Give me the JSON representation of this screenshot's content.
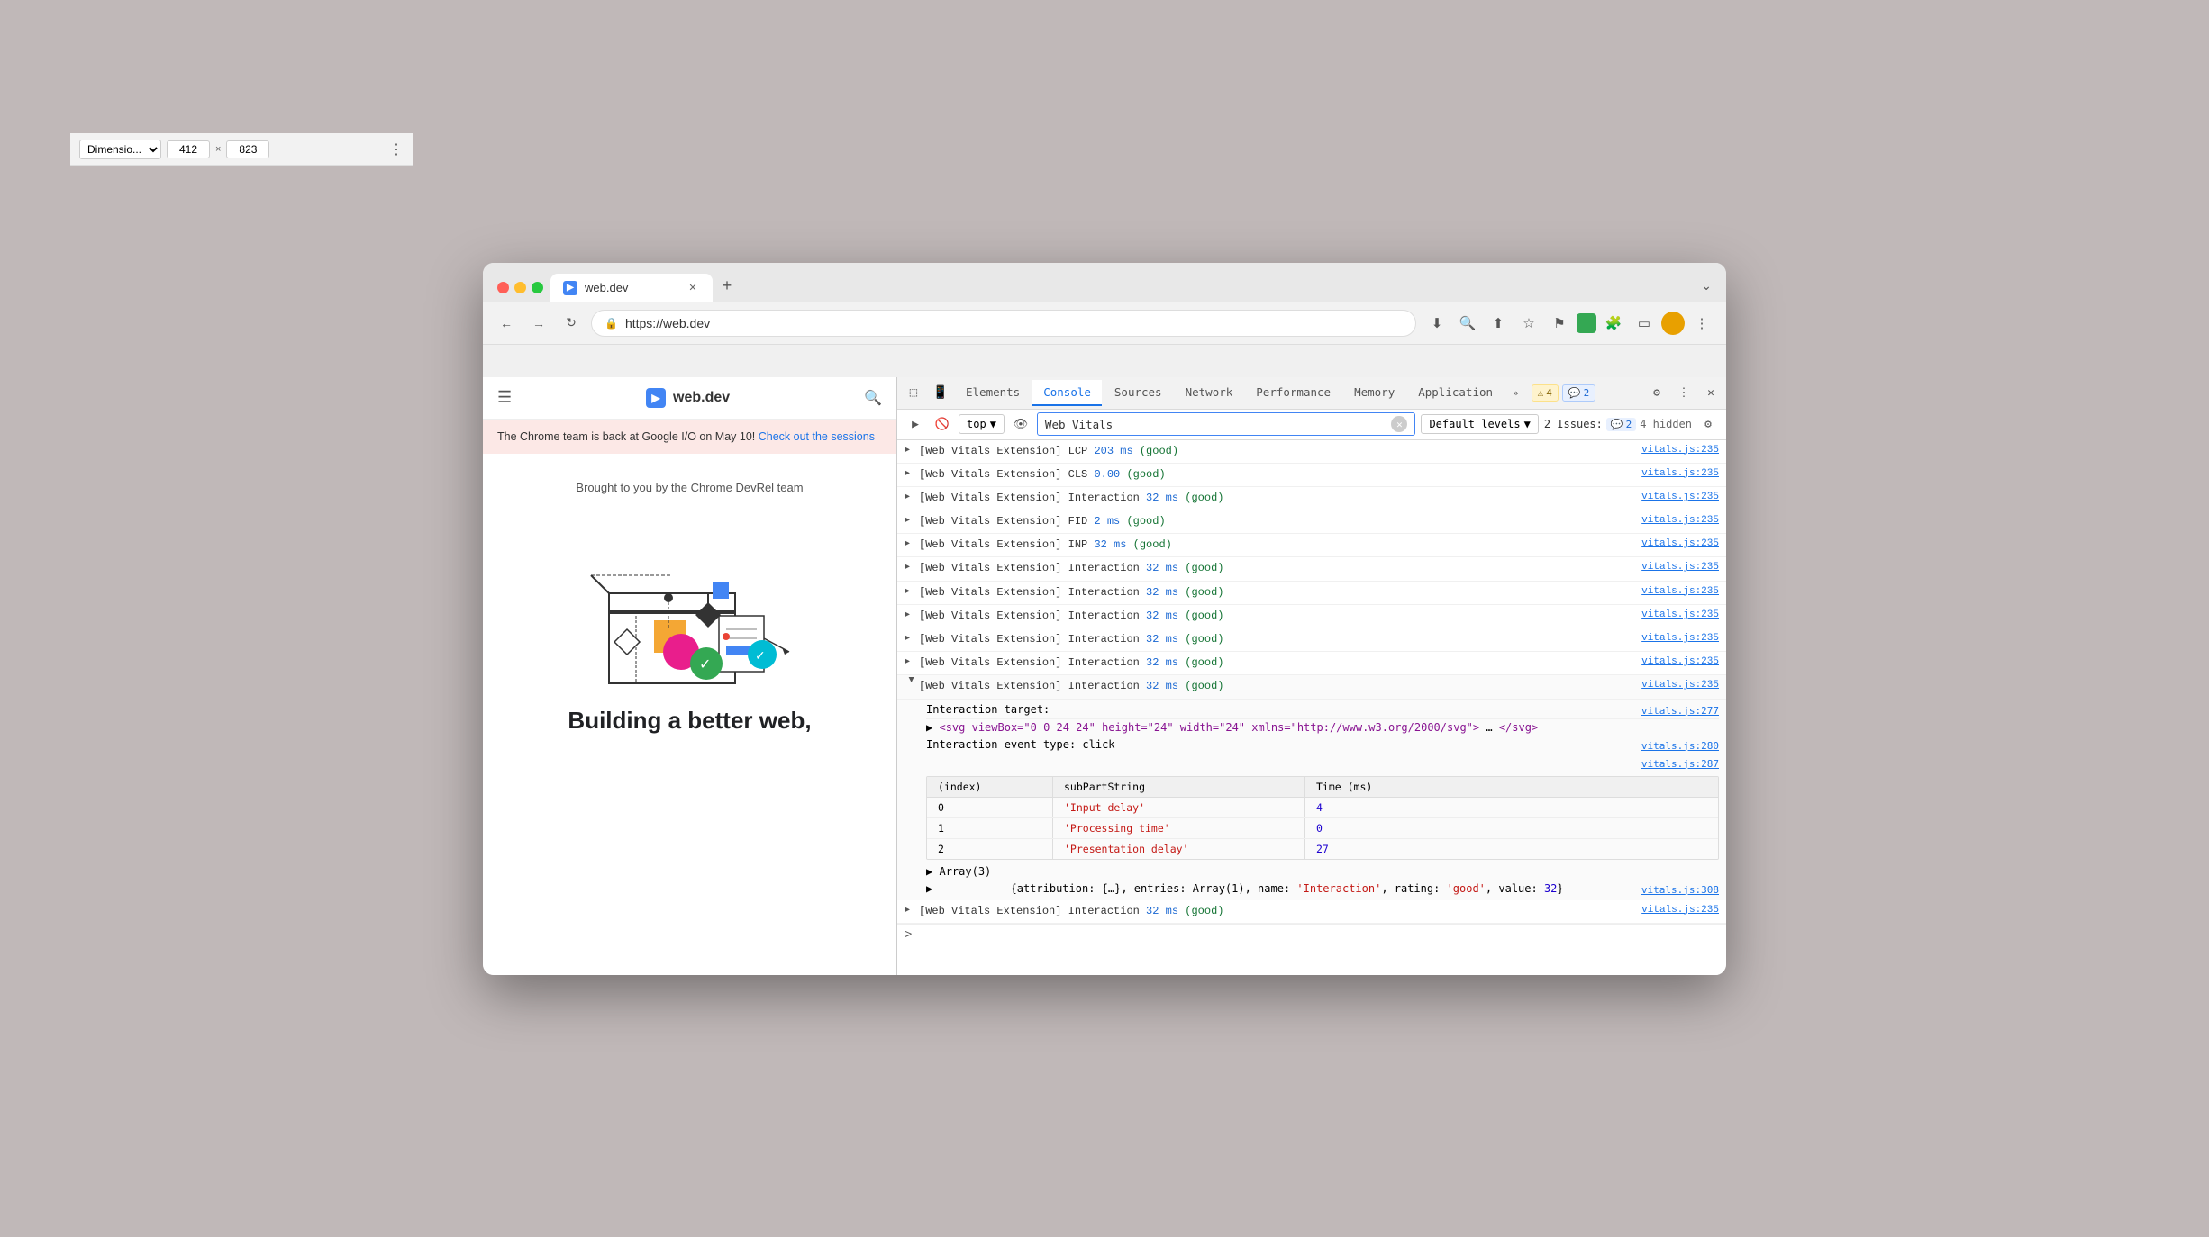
{
  "browser": {
    "tab_title": "web.dev",
    "tab_favicon": "▶",
    "url": "https://web.dev",
    "new_tab_label": "+",
    "chevron_down": "⌄",
    "nav": {
      "back_label": "←",
      "forward_label": "→",
      "reload_label": "↻",
      "lock_label": "🔒",
      "download_label": "⬇",
      "zoom_label": "🔍",
      "share_label": "⬆",
      "star_label": "☆",
      "flag_label": "⚑",
      "ext_label": "🟩",
      "puzzle_label": "🧩",
      "sidebar_label": "▭",
      "profile_label": "👤",
      "more_label": "⋮"
    }
  },
  "devtools": {
    "dimension_label": "Dimensio...",
    "width": "412",
    "x_label": "×",
    "height": "823",
    "more_dots": "⋮",
    "inspect_icon": "⬚",
    "device_icon": "📱",
    "tabs": [
      {
        "label": "Elements",
        "active": false
      },
      {
        "label": "Console",
        "active": true
      },
      {
        "label": "Sources",
        "active": false
      },
      {
        "label": "Network",
        "active": false
      },
      {
        "label": "Performance",
        "active": false
      },
      {
        "label": "Memory",
        "active": false
      },
      {
        "label": "Application",
        "active": false
      }
    ],
    "more_tabs": "»",
    "badge_warn_count": "4",
    "badge_warn_icon": "⚠",
    "badge_info_count": "2",
    "badge_info_icon": "💬",
    "settings_icon": "⚙",
    "more_icon": "⋮",
    "close_icon": "✕",
    "console": {
      "exec_icon": "▶",
      "stop_icon": "🚫",
      "context_label": "top",
      "context_arrow": "▼",
      "eye_icon": "👁",
      "filter_text": "Web Vitals",
      "filter_clear": "✕",
      "levels_label": "Default levels",
      "levels_arrow": "▼",
      "issues_label": "2 Issues:",
      "issues_count": "2",
      "hidden_label": "4 hidden",
      "gear_icon": "⚙"
    },
    "log_entries": [
      {
        "expanded": false,
        "text_parts": [
          {
            "type": "prefix",
            "text": "[Web Vitals Extension] LCP "
          },
          {
            "type": "value",
            "text": "203 ms"
          },
          {
            "type": "good",
            "text": " (good)"
          }
        ],
        "source": "vitals.js:235"
      },
      {
        "expanded": false,
        "text_parts": [
          {
            "type": "prefix",
            "text": "[Web Vitals Extension] CLS "
          },
          {
            "type": "value",
            "text": "0.00"
          },
          {
            "type": "good",
            "text": " (good)"
          }
        ],
        "source": "vitals.js:235"
      },
      {
        "expanded": false,
        "text_parts": [
          {
            "type": "prefix",
            "text": "[Web Vitals Extension] Interaction "
          },
          {
            "type": "value",
            "text": "32 ms"
          },
          {
            "type": "good",
            "text": " (good)"
          }
        ],
        "source": "vitals.js:235"
      },
      {
        "expanded": false,
        "text_parts": [
          {
            "type": "prefix",
            "text": "[Web Vitals Extension] FID "
          },
          {
            "type": "value",
            "text": "2 ms"
          },
          {
            "type": "good",
            "text": " (good)"
          }
        ],
        "source": "vitals.js:235"
      },
      {
        "expanded": false,
        "text_parts": [
          {
            "type": "prefix",
            "text": "[Web Vitals Extension] INP "
          },
          {
            "type": "value",
            "text": "32 ms"
          },
          {
            "type": "good",
            "text": " (good)"
          }
        ],
        "source": "vitals.js:235"
      },
      {
        "expanded": false,
        "text_parts": [
          {
            "type": "prefix",
            "text": "[Web Vitals Extension] Interaction "
          },
          {
            "type": "value",
            "text": "32 ms"
          },
          {
            "type": "good",
            "text": " (good)"
          }
        ],
        "source": "vitals.js:235"
      },
      {
        "expanded": false,
        "text_parts": [
          {
            "type": "prefix",
            "text": "[Web Vitals Extension] Interaction "
          },
          {
            "type": "value",
            "text": "32 ms"
          },
          {
            "type": "good",
            "text": " (good)"
          }
        ],
        "source": "vitals.js:235"
      },
      {
        "expanded": false,
        "text_parts": [
          {
            "type": "prefix",
            "text": "[Web Vitals Extension] Interaction "
          },
          {
            "type": "value",
            "text": "32 ms"
          },
          {
            "type": "good",
            "text": " (good)"
          }
        ],
        "source": "vitals.js:235"
      },
      {
        "expanded": false,
        "text_parts": [
          {
            "type": "prefix",
            "text": "[Web Vitals Extension] Interaction "
          },
          {
            "type": "value",
            "text": "32 ms"
          },
          {
            "type": "good",
            "text": " (good)"
          }
        ],
        "source": "vitals.js:235"
      },
      {
        "expanded": false,
        "text_parts": [
          {
            "type": "prefix",
            "text": "[Web Vitals Extension] Interaction "
          },
          {
            "type": "value",
            "text": "32 ms"
          },
          {
            "type": "good",
            "text": " (good)"
          }
        ],
        "source": "vitals.js:235"
      }
    ],
    "expanded_entry": {
      "text_parts": [
        {
          "type": "prefix",
          "text": "[Web Vitals Extension] Interaction "
        },
        {
          "type": "value",
          "text": "32 ms"
        },
        {
          "type": "good",
          "text": " (good)"
        }
      ],
      "source_main": "vitals.js:235",
      "sub_lines": [
        {
          "text": "Interaction target:",
          "source": "vitals.js:277"
        },
        {
          "text": "▶ <svg viewBox=\"0 0 24 24\" height=\"24\" width=\"24\" xmlns=\"http://www.w3.org/2000/svg\"> … </svg>",
          "source": ""
        },
        {
          "text": "Interaction event type: click",
          "source": "vitals.js:280"
        },
        {
          "text": "",
          "source": "vitals.js:287"
        }
      ],
      "table": {
        "headers": [
          "(index)",
          "subPartString",
          "Time (ms)"
        ],
        "rows": [
          {
            "index": "0",
            "sub": "'Input delay'",
            "time": "4"
          },
          {
            "index": "1",
            "sub": "'Processing time'",
            "time": "0"
          },
          {
            "index": "2",
            "sub": "'Presentation delay'",
            "time": "27"
          }
        ]
      },
      "array_line": "▶ Array(3)",
      "attribution_line": "▶ {attribution: {…}, entries: Array(1), name: 'Interaction', rating: 'good', value: 32}",
      "attribution_source": "vitals.js:308"
    },
    "last_entry": {
      "text_parts": [
        {
          "type": "prefix",
          "text": "[Web Vitals Extension] Interaction "
        },
        {
          "type": "value",
          "text": "32 ms"
        },
        {
          "type": "good",
          "text": " (good)"
        }
      ],
      "source": "vitals.js:235"
    },
    "prompt": ">"
  },
  "site": {
    "logo_text": "web.dev",
    "notification_text": "The Chrome team is back at Google I/O on May 10! ",
    "notification_link": "Check out the sessions",
    "credit_text": "Brought to you by the Chrome DevRel team",
    "hero_title": "Building a better web,"
  }
}
